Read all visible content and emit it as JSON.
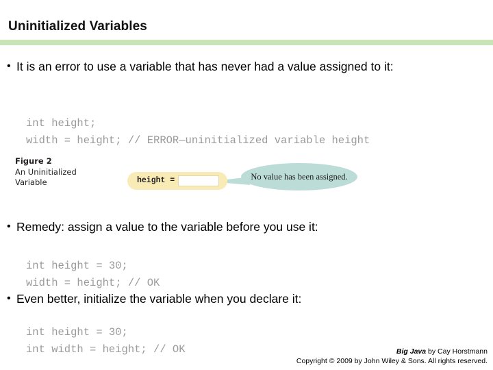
{
  "slide": {
    "title": "Uninitialized Variables",
    "rule_color": "#c9e4b7"
  },
  "bullets": [
    {
      "marker": "•",
      "text": "It is an error to use a variable that has never had a value assigned to it:"
    },
    {
      "marker": "•",
      "text": "Remedy: assign a value to the variable before you use it:"
    },
    {
      "marker": "•",
      "text": "Even better, initialize the variable when you declare it:"
    }
  ],
  "code_blocks": [
    {
      "id": "code-1",
      "text": "int height;\nwidth = height; // ERROR—uninitialized variable height"
    },
    {
      "id": "code-2",
      "text": "int height = 30;\nwidth = height; // OK"
    },
    {
      "id": "code-3",
      "text": "int height = 30;\nint width = height; // OK"
    }
  ],
  "figure": {
    "label": "Figure 2",
    "caption_line1": "An Uninitialized",
    "caption_line2": "Variable",
    "variable_name": "height =",
    "variable_value": "",
    "callout_text": "No value has been assigned.",
    "box_color": "#f9ebb6",
    "callout_color": "#bcdcd8"
  },
  "footer": {
    "book_title": "Big Java",
    "byline": " by Cay Horstmann",
    "copyright": "Copyright © 2009 by John Wiley & Sons.  All rights reserved."
  }
}
